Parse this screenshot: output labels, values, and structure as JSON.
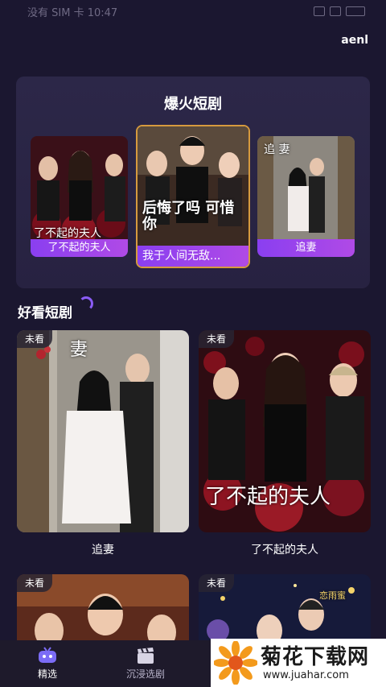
{
  "status_bar": {
    "text": "没有 SIM 卡 10:47"
  },
  "header": {
    "user": "aenl"
  },
  "hot_section": {
    "title": "爆火短剧",
    "cards": [
      {
        "label": "了不起的夫人",
        "poster_title": "了不起的夫人"
      },
      {
        "label": "我于人间无敌...",
        "poster_title": "后悔了吗 可惜你"
      },
      {
        "label": "追妻",
        "poster_title": "追 妻"
      }
    ]
  },
  "recommend_section": {
    "title": "好看短剧",
    "badge": "未看",
    "cards": [
      {
        "caption": "追妻",
        "poster_title": "妻"
      },
      {
        "caption": "了不起的夫人",
        "poster_title": "了不起的夫人"
      },
      {
        "caption": ""
      },
      {
        "caption": "",
        "poster_title": "恋雨蜜"
      }
    ]
  },
  "bottom_nav": {
    "items": [
      {
        "label": "精选",
        "icon": "tv-icon",
        "active": true
      },
      {
        "label": "沉浸选剧",
        "icon": "clapperboard-icon",
        "active": false
      }
    ]
  },
  "watermark": {
    "name": "菊花下载网",
    "url": "www.juahar.com"
  },
  "colors": {
    "background": "#1b1730",
    "accent": "#9b45ee",
    "panel": "#2c2748"
  }
}
